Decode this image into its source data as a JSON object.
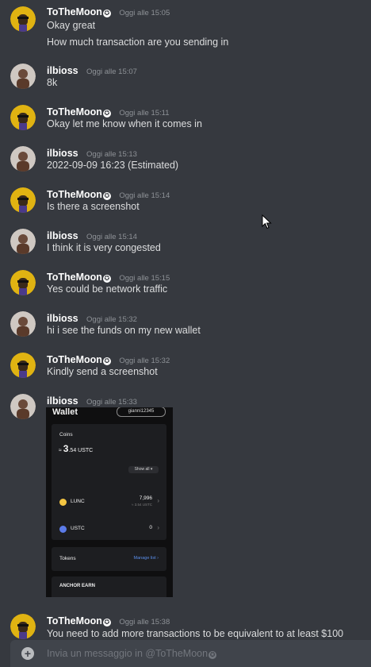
{
  "users": {
    "a": "ToTheMoon",
    "b": "ilbioss"
  },
  "messages": [
    {
      "author": "ToTheMoon",
      "time": "Oggi alle 15:05",
      "lines": [
        "Okay great",
        "How much transaction are you sending in"
      ]
    },
    {
      "author": "ilbioss",
      "time": "Oggi alle 15:07",
      "lines": [
        "8k"
      ]
    },
    {
      "author": "ToTheMoon",
      "time": "Oggi alle 15:11",
      "lines": [
        "Okay let me know when it comes in"
      ]
    },
    {
      "author": "ilbioss",
      "time": "Oggi alle 15:13",
      "lines": [
        "2022-09-09 16:23 (Estimated)"
      ]
    },
    {
      "author": "ToTheMoon",
      "time": "Oggi alle 15:14",
      "lines": [
        "Is there a screenshot"
      ]
    },
    {
      "author": "ilbioss",
      "time": "Oggi alle 15:14",
      "lines": [
        "I think it is very congested"
      ]
    },
    {
      "author": "ToTheMoon",
      "time": "Oggi alle 15:15",
      "lines": [
        "Yes could be network traffic"
      ]
    },
    {
      "author": "ilbioss",
      "time": "Oggi alle 15:32",
      "lines": [
        "hi i see the funds on my new wallet"
      ]
    },
    {
      "author": "ToTheMoon",
      "time": "Oggi alle 15:32",
      "lines": [
        "Kindly send a screenshot"
      ]
    },
    {
      "author": "ilbioss",
      "time": "Oggi alle 15:33",
      "lines": []
    },
    {
      "author": "ToTheMoon",
      "time": "Oggi alle 15:38",
      "lines": [
        "You need to add more transactions to be equivalent to at least $100"
      ]
    }
  ],
  "wallet_image": {
    "title": "Wallet",
    "username": "gianni12345",
    "coins_label": "Coins",
    "approx": "≈",
    "total_main": "3",
    "total_sub": ".54 USTC",
    "show_all": "Show all ▾",
    "assets": [
      {
        "ticker": "LUNC",
        "amount": "7,996",
        "sub": "≈ 3.54 USTC",
        "color": "#f4c542"
      },
      {
        "ticker": "USTC",
        "amount": "0",
        "sub": "",
        "color": "#5b7be8"
      }
    ],
    "tokens_label": "Tokens",
    "manage_list": "Manage list ›",
    "anchor_label": "ANCHOR EARN"
  },
  "composer": {
    "placeholder": "Invia un messaggio in @ToTheMoon"
  },
  "colors": {
    "background": "#36393f",
    "username": "#ffffff",
    "timestamp": "#8e9297",
    "text": "#dcddde",
    "composer": "#40444b"
  }
}
